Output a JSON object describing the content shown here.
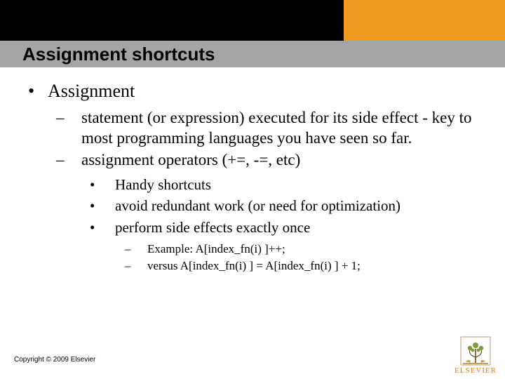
{
  "title": "Assignment shortcuts",
  "bullets": {
    "l1": "Assignment",
    "l2a": "statement (or expression) executed for its side effect - key to most programming languages you have seen so far.",
    "l2b": "assignment operators (+=, -=, etc)",
    "l3a": "Handy shortcuts",
    "l3b": "avoid redundant work (or need for optimization)",
    "l3c": "perform side effects exactly once",
    "l4a": "Example: A[index_fn(i) ]++;",
    "l4b": "versus A[index_fn(i) ] = A[index_fn(i) ] + 1;"
  },
  "copyright": "Copyright © 2009 Elsevier",
  "logo_text": "ELSEVIER"
}
